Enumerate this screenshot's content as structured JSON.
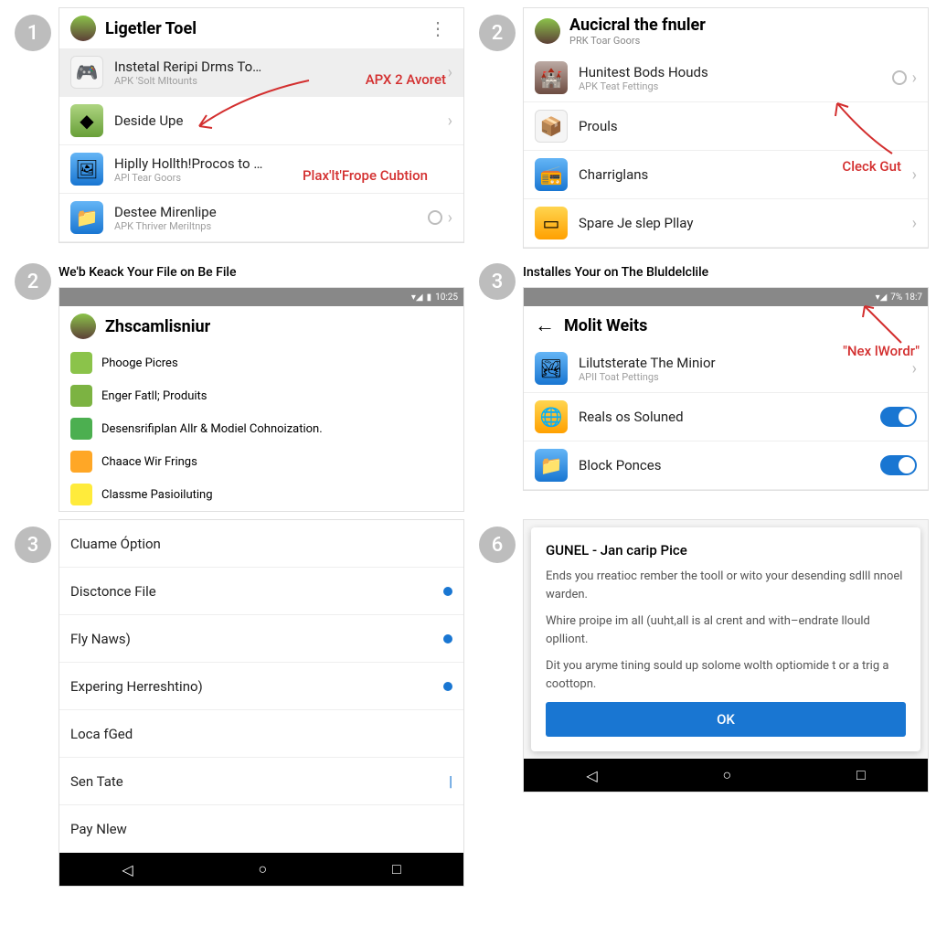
{
  "p1": {
    "badge": "1",
    "title": "Ligetler Toel",
    "items": [
      {
        "label": "Instetal Reripi Drms To…",
        "sub": "APK 'Solt Mltounts",
        "sel": true
      },
      {
        "label": "Deside Upe",
        "sub": ""
      },
      {
        "label": "Hiplly Hollth!Procos to …",
        "sub": "APl Tear Goors"
      },
      {
        "label": "Destee Mirenlipe",
        "sub": "APK Thriver Meriltnps"
      }
    ],
    "ann1": "APX 2 Avoret",
    "ann2": "Plax'lt'Frope Cubtion"
  },
  "p2": {
    "badge": "2",
    "title": "Aucicral the fnuler",
    "titlesub": "PRK Toar Goors",
    "items": [
      {
        "label": "Hunitest Bods Houds",
        "sub": "APK Teat Fettings"
      },
      {
        "label": "Prouls",
        "sub": ""
      },
      {
        "label": "Charriglans",
        "sub": ""
      },
      {
        "label": "Spare Je slep Pllay",
        "sub": ""
      }
    ],
    "ann": "Cleck Gut"
  },
  "p3": {
    "badge": "2",
    "caption": "We'b Keack Your File on Be File",
    "status": "10:25",
    "title": "Zhscamlisniur",
    "items": [
      {
        "label": "Phooge Picres"
      },
      {
        "label": "Enger Fatll; Produits"
      },
      {
        "label": "Desensrifiplan Allr & Modiel Cohnoization."
      },
      {
        "label": "Chaace Wir Frings"
      },
      {
        "label": "Classme Pasioiluting"
      }
    ]
  },
  "p4": {
    "badge": "3",
    "caption": "Installes Your on The Bluldelclile",
    "status": "7% 18:7",
    "title": "Molit Weits",
    "items": [
      {
        "label": "Lilutsterate The Minior",
        "sub": "APII Toat Pettings"
      },
      {
        "label": "Reals os Soluned"
      },
      {
        "label": "Block Ponces"
      }
    ],
    "ann": "\"Nex lWordr\""
  },
  "p5": {
    "badge": "3",
    "items": [
      {
        "label": "Cluame Óption"
      },
      {
        "label": "Disctonce File"
      },
      {
        "label": "Fly Naws)"
      },
      {
        "label": "Expering Herreshtino)"
      },
      {
        "label": "Loca fGed"
      },
      {
        "label": "Sen Tate"
      },
      {
        "label": "Pay Nlew"
      }
    ]
  },
  "p6": {
    "badge": "6",
    "title": "GUNEL - Jan carip Pice",
    "text1": "Ends you rreatioc rember the tooll or wito your desending sdlll nnoel warden.",
    "text2": "Whire proipe im all (uuht,all is al crent and with–endrate llould oplliont.",
    "text3": "Dit you aryme tining sould up solome wolth optiomide t or a trig a coottopn.",
    "ok": "OK"
  }
}
